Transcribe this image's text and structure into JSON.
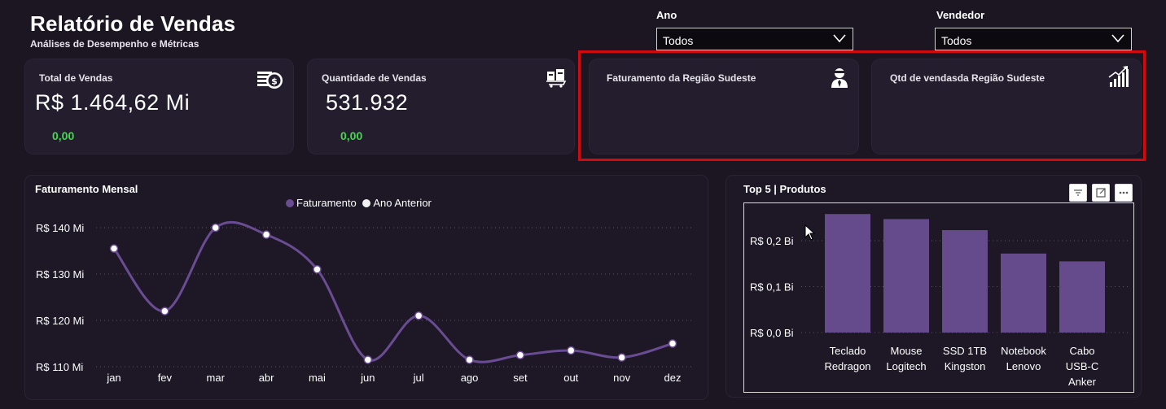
{
  "header": {
    "title": "Relatório de Vendas",
    "subtitle": "Análises de Desempenho e Métricas"
  },
  "filters": [
    {
      "label": "Ano",
      "value": "Todos"
    },
    {
      "label": "Vendedor",
      "value": "Todos"
    }
  ],
  "cards": [
    {
      "title": "Total de Vendas",
      "value": "R$ 1.464,62 Mi",
      "delta": "0,00",
      "icon": "money-icon"
    },
    {
      "title": "Quantidade de Vendas",
      "value": "531.932",
      "delta": "0,00",
      "icon": "shopping-icon"
    },
    {
      "title": "Faturamento da Região Sudeste",
      "icon": "salesperson-icon"
    },
    {
      "title": "Qtd de vendasda Região Sudeste",
      "icon": "growth-chart-icon"
    }
  ],
  "colors": {
    "background": "#1b1622",
    "card": "#241d2e",
    "accent": "#6a4c93",
    "bar": "#654b8c",
    "positive": "#3fdc4a",
    "highlight_border": "#d10a0f"
  },
  "line_chart": {
    "title": "Faturamento Mensal",
    "legend": [
      "Faturamento",
      "Ano Anterior"
    ]
  },
  "bar_chart": {
    "title": "Top 5 | Produtos"
  },
  "chart_data": [
    {
      "type": "line",
      "title": "Faturamento Mensal",
      "x": [
        "jan",
        "fev",
        "mar",
        "abr",
        "mai",
        "jun",
        "jul",
        "ago",
        "set",
        "out",
        "nov",
        "dez"
      ],
      "series": [
        {
          "name": "Faturamento",
          "values": [
            135.5,
            122.0,
            140.0,
            138.5,
            131.0,
            111.5,
            121.0,
            111.5,
            112.5,
            113.5,
            112.0,
            115.0
          ]
        },
        {
          "name": "Ano Anterior",
          "values": [
            135.5,
            122.0,
            140.0,
            138.5,
            131.0,
            111.5,
            121.0,
            111.5,
            112.5,
            113.5,
            112.0,
            115.0
          ]
        }
      ],
      "yticks": [
        "R$ 110 Mi",
        "R$ 120 Mi",
        "R$ 130 Mi",
        "R$ 140 Mi"
      ],
      "ytick_values": [
        110,
        120,
        130,
        140
      ],
      "ylim": [
        110,
        140
      ],
      "grid": true,
      "legend_position": "top"
    },
    {
      "type": "bar",
      "title": "Top 5 | Produtos",
      "categories": [
        [
          "Teclado",
          "Redragon"
        ],
        [
          "Mouse",
          "Logitech"
        ],
        [
          "SSD 1TB",
          "Kingston"
        ],
        [
          "Notebook",
          "Lenovo"
        ],
        [
          "Cabo",
          "USB-C",
          "Anker"
        ]
      ],
      "values": [
        0.258,
        0.247,
        0.223,
        0.172,
        0.155
      ],
      "yticks": [
        "R$ 0,0 Bi",
        "R$ 0,1 Bi",
        "R$ 0,2 Bi"
      ],
      "ytick_values": [
        0,
        0.1,
        0.2
      ],
      "grid": true
    }
  ]
}
